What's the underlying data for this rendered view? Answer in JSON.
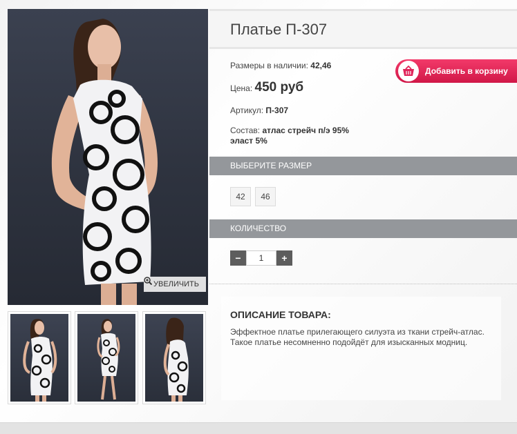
{
  "product": {
    "title": "Платье П-307",
    "sizes_available_label": "Размеры в наличии:",
    "sizes_available_value": "42,46",
    "price_label": "Цена:",
    "price_value": "450 руб",
    "article_label": "Артикул:",
    "article_value": "П-307",
    "composition_label": "Состав:",
    "composition_value_line1": "атлас стрейч п/э 95%",
    "composition_value_line2": "эласт 5%"
  },
  "buttons": {
    "add_to_cart": "Добавить в корзину",
    "zoom": "УВЕЛИЧИТЬ"
  },
  "size_section": {
    "header": "ВЫБЕРИТЕ РАЗМЕР",
    "options": [
      "42",
      "46"
    ]
  },
  "quantity_section": {
    "header": "КОЛИЧЕСТВО",
    "value": "1",
    "minus": "−",
    "plus": "+"
  },
  "description": {
    "header": "ОПИСАНИЕ ТОВАРА:",
    "text": "Эффектное платье прилегающего силуэта из ткани стрейч-атлас. Такое платье несомненно подойдёт для изысканных модниц."
  },
  "icons": {
    "zoom": "magnifier-plus-icon",
    "cart": "basket-icon"
  },
  "colors": {
    "accent": "#e0245a",
    "section_bar": "#94979b"
  }
}
